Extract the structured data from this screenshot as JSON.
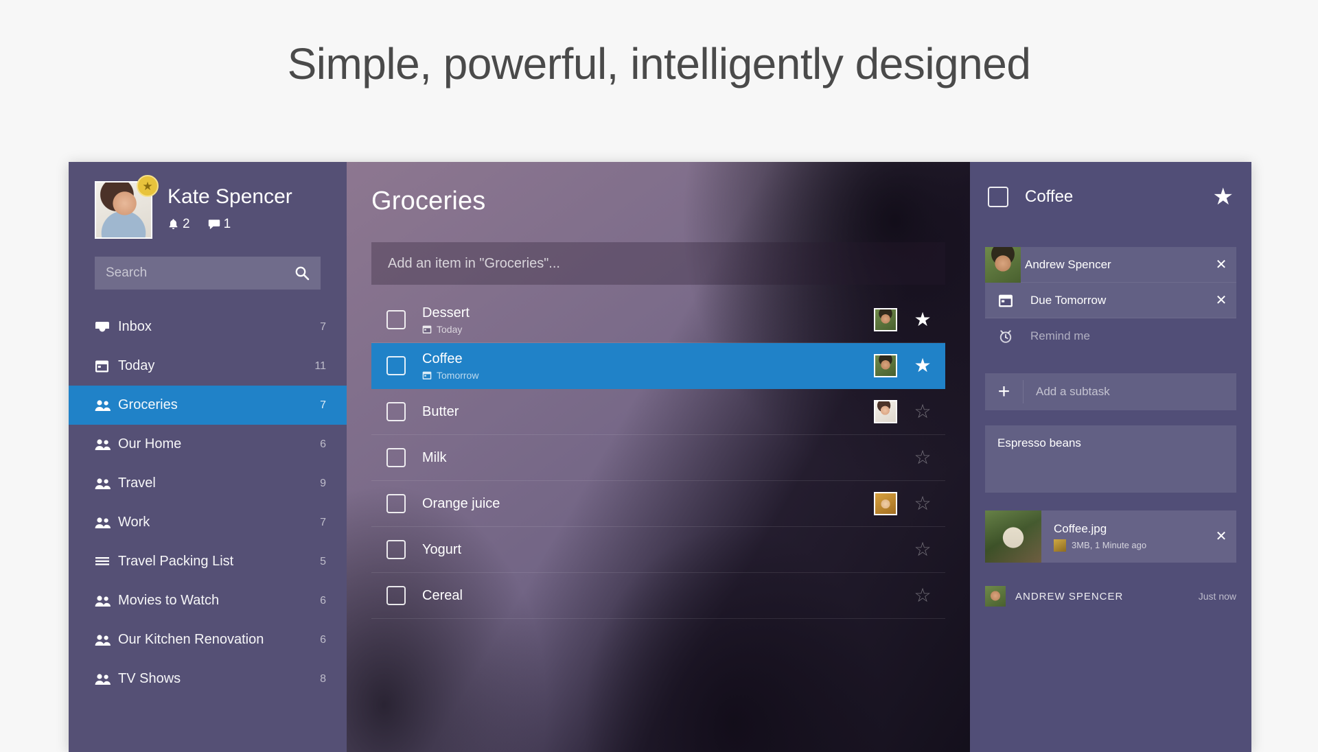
{
  "headline": "Simple, powerful, intelligently designed",
  "sidebar": {
    "profile": {
      "name": "Kate Spencer",
      "badge_icon": "star-badge-icon",
      "notification_count": "2",
      "comment_count": "1"
    },
    "search": {
      "placeholder": "Search",
      "value": "",
      "icon": "search-icon"
    },
    "items": [
      {
        "label": "Inbox",
        "count": "7",
        "icon": "inbox-icon",
        "active": false
      },
      {
        "label": "Today",
        "count": "11",
        "icon": "calendar-icon",
        "active": false
      },
      {
        "label": "Groceries",
        "count": "7",
        "icon": "people-icon",
        "active": true
      },
      {
        "label": "Our Home",
        "count": "6",
        "icon": "people-icon",
        "active": false
      },
      {
        "label": "Travel",
        "count": "9",
        "icon": "people-icon",
        "active": false
      },
      {
        "label": "Work",
        "count": "7",
        "icon": "people-icon",
        "active": false
      },
      {
        "label": "Travel Packing List",
        "count": "5",
        "icon": "list-icon",
        "active": false
      },
      {
        "label": "Movies to Watch",
        "count": "6",
        "icon": "people-icon",
        "active": false
      },
      {
        "label": "Our Kitchen Renovation",
        "count": "6",
        "icon": "people-icon",
        "active": false
      },
      {
        "label": "TV Shows",
        "count": "8",
        "icon": "people-icon",
        "active": false
      }
    ]
  },
  "main": {
    "title": "Groceries",
    "add_item": {
      "placeholder": "Add an item in \"Groceries\"...",
      "value": ""
    },
    "tasks": [
      {
        "title": "Dessert",
        "due": "Today",
        "has_due": true,
        "avatar": "av-andrew",
        "starred": true,
        "selected": false
      },
      {
        "title": "Coffee",
        "due": "Tomorrow",
        "has_due": true,
        "avatar": "av-andrew",
        "starred": true,
        "selected": true
      },
      {
        "title": "Butter",
        "due": "",
        "has_due": false,
        "avatar": "av-kate",
        "starred": false,
        "selected": false
      },
      {
        "title": "Milk",
        "due": "",
        "has_due": false,
        "avatar": "",
        "starred": false,
        "selected": false
      },
      {
        "title": "Orange juice",
        "due": "",
        "has_due": false,
        "avatar": "av-girl",
        "starred": false,
        "selected": false
      },
      {
        "title": "Yogurt",
        "due": "",
        "has_due": false,
        "avatar": "",
        "starred": false,
        "selected": false
      },
      {
        "title": "Cereal",
        "due": "",
        "has_due": false,
        "avatar": "",
        "starred": false,
        "selected": false
      }
    ]
  },
  "detail": {
    "title": "Coffee",
    "starred": true,
    "star_icon": "star-filled-icon",
    "rows": [
      {
        "label": "Andrew Spencer",
        "icon": "avatar",
        "removable": true,
        "muted": false
      },
      {
        "label": "Due Tomorrow",
        "icon": "calendar-icon",
        "removable": true,
        "muted": false
      },
      {
        "label": "Remind me",
        "icon": "alarm-icon",
        "removable": false,
        "muted": true
      }
    ],
    "subtask": {
      "placeholder": "Add a subtask",
      "value": "",
      "icon": "plus-icon"
    },
    "note": "Espresso beans",
    "attachment": {
      "name": "Coffee.jpg",
      "meta": "3MB, 1 Minute ago",
      "remove_icon": "close-icon"
    },
    "comment": {
      "author": "ANDREW SPENCER",
      "time": "Just now"
    }
  },
  "colors": {
    "accent": "#2082c8",
    "sidebar_bg": "#555075",
    "detail_bg": "#514e77",
    "badge": "#e8c33c"
  }
}
